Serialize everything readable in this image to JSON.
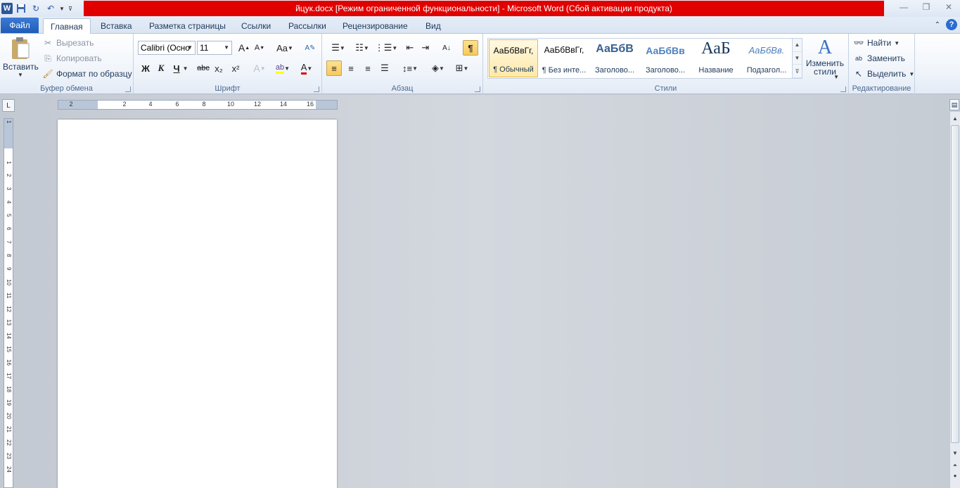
{
  "titlebar": {
    "title": "йцук.docx [Режим ограниченной функциональности]  -  Microsoft Word (Сбой активации продукта)",
    "app_icon": "W"
  },
  "tabs": {
    "file": "Файл",
    "items": [
      "Главная",
      "Вставка",
      "Разметка страницы",
      "Ссылки",
      "Рассылки",
      "Рецензирование",
      "Вид"
    ]
  },
  "clipboard": {
    "paste": "Вставить",
    "cut": "Вырезать",
    "copy": "Копировать",
    "format_painter": "Формат по образцу",
    "label": "Буфер обмена"
  },
  "font": {
    "name": "Calibri (Осно",
    "size": "11",
    "label": "Шрифт",
    "bold": "Ж",
    "italic": "К",
    "underline": "Ч",
    "strike": "abc",
    "subscript": "x₂",
    "superscript": "x²",
    "grow": "A",
    "shrink": "A",
    "case": "Aa",
    "color_letter": "A"
  },
  "paragraph": {
    "label": "Абзац",
    "pilcrow": "¶"
  },
  "styles": {
    "label": "Стили",
    "change": "Изменить стили",
    "items": [
      {
        "preview": "АаБбВвГг,",
        "name": "¶ Обычный"
      },
      {
        "preview": "АаБбВвГг,",
        "name": "¶ Без инте..."
      },
      {
        "preview": "АаБбВ",
        "name": "Заголово..."
      },
      {
        "preview": "АаБбВв",
        "name": "Заголово..."
      },
      {
        "preview": "АаБ",
        "name": "Название"
      },
      {
        "preview": "АаБбВв.",
        "name": "Подзагол..."
      }
    ]
  },
  "editing": {
    "label": "Редактирование",
    "find": "Найти",
    "replace": "Заменить",
    "select": "Выделить"
  },
  "ruler": {
    "h_labels": [
      "2",
      "2",
      "4",
      "6",
      "8",
      "10",
      "12",
      "14",
      "16"
    ],
    "v_labels": [
      "1",
      "1",
      "2",
      "3",
      "4",
      "5",
      "6",
      "7",
      "8",
      "9",
      "10",
      "11",
      "12",
      "13",
      "14",
      "15",
      "16",
      "17",
      "18",
      "19",
      "20",
      "21",
      "22",
      "23",
      "24"
    ]
  },
  "colors": {
    "title_bar_alert": "#e00000",
    "file_tab": "#1f5cb8",
    "highlight": "#ffff00",
    "font_color": "#e00000"
  }
}
